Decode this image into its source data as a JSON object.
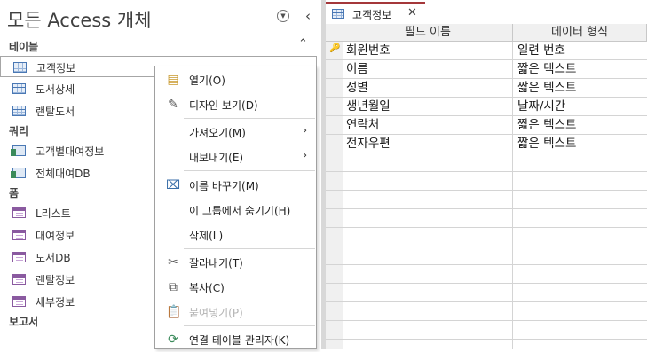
{
  "nav": {
    "title": "모든 Access 개체",
    "groups": [
      {
        "label": "테이블",
        "items": [
          {
            "label": "고객정보"
          },
          {
            "label": "도서상세"
          },
          {
            "label": "랜탈도서"
          }
        ]
      },
      {
        "label": "쿼리",
        "items": [
          {
            "label": "고객별대여정보"
          },
          {
            "label": "전체대여DB"
          }
        ]
      },
      {
        "label": "폼",
        "items": [
          {
            "label": "L리스트"
          },
          {
            "label": "대여정보"
          },
          {
            "label": "도서DB"
          },
          {
            "label": "랜탈정보"
          },
          {
            "label": "세부정보"
          }
        ]
      },
      {
        "label": "보고서",
        "items": []
      }
    ]
  },
  "context_menu": {
    "items": [
      {
        "label": "열기(O)",
        "icon": "open-icon"
      },
      {
        "label": "디자인 보기(D)",
        "icon": "design-view-icon"
      },
      {
        "label": "가져오기(M)",
        "submenu": true
      },
      {
        "label": "내보내기(E)",
        "submenu": true
      },
      {
        "label": "이름 바꾸기(M)",
        "icon": "rename-icon"
      },
      {
        "label": "이 그룹에서 숨기기(H)"
      },
      {
        "label": "삭제(L)"
      },
      {
        "label": "잘라내기(T)",
        "icon": "scissors-icon"
      },
      {
        "label": "복사(C)",
        "icon": "copy-icon"
      },
      {
        "label": "붙여넣기(P)",
        "icon": "paste-icon",
        "disabled": true
      },
      {
        "label": "연결 테이블 관리자(K)",
        "icon": "linked-table-manager-icon"
      }
    ]
  },
  "document": {
    "tab_label": "고객정보",
    "columns": [
      "필드 이름",
      "데이터 형식"
    ],
    "rows": [
      {
        "field": "회원번호",
        "type": "일련 번호",
        "primary_key": true
      },
      {
        "field": "이름",
        "type": "짧은 텍스트"
      },
      {
        "field": "성별",
        "type": "짧은 텍스트"
      },
      {
        "field": "생년월일",
        "type": "날짜/시간"
      },
      {
        "field": "연락처",
        "type": "짧은 텍스트"
      },
      {
        "field": "전자우편",
        "type": "짧은 텍스트"
      }
    ]
  },
  "colors": {
    "accent": "#a4373a",
    "selection_border": "#a6a6a6"
  }
}
